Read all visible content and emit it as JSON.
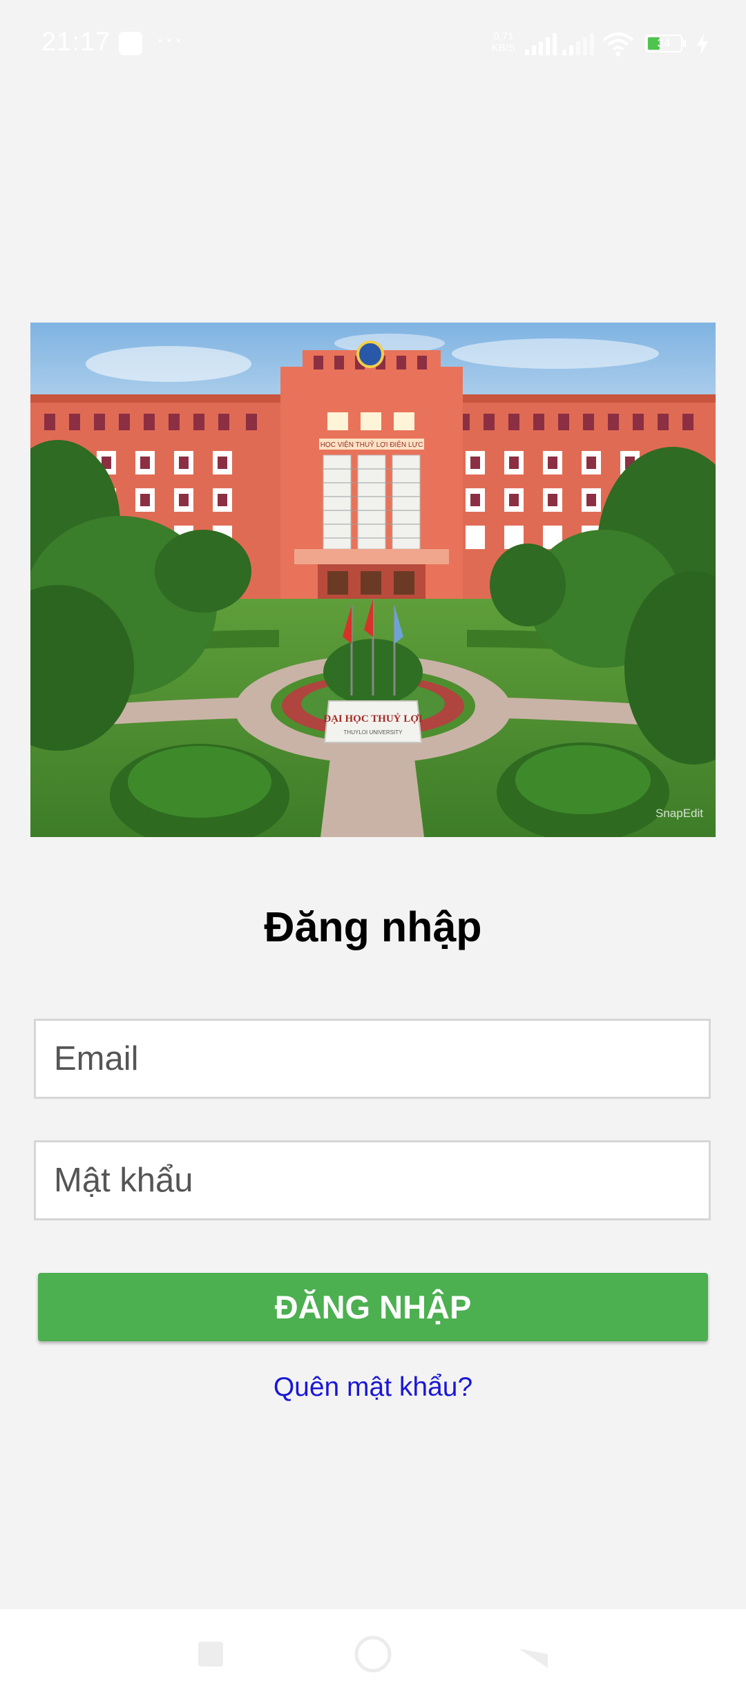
{
  "status_bar": {
    "time": "21:17",
    "more": "···",
    "net_speed_value": "0,71",
    "net_speed_unit": "KB/S",
    "battery_level": "34"
  },
  "photo": {
    "watermark": "SnapEdit",
    "building_sign": "HỌC VIỆN THUỶ LỢI ĐIỆN LỰC",
    "monument_title": "ĐẠI HỌC THUỶ LỢI",
    "monument_subtitle": "THUYLOI UNIVERSITY"
  },
  "login": {
    "title": "Đăng nhập",
    "email_placeholder": "Email",
    "password_placeholder": "Mật khẩu",
    "submit_label": "ĐĂNG NHẬP",
    "forgot_password": "Quên mật khẩu?"
  },
  "colors": {
    "background": "#f3f3f3",
    "primary_button": "#4caf50",
    "link": "#1a17d6",
    "input_border": "#d6d6d6"
  },
  "icons": {
    "status": [
      "app-notification-icon",
      "signal-icon",
      "wifi-icon",
      "battery-icon",
      "charging-icon"
    ],
    "navigation": [
      "recents-icon",
      "home-icon",
      "back-icon"
    ]
  }
}
